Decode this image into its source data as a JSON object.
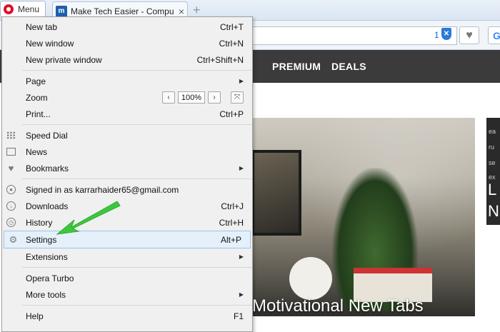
{
  "browser": {
    "menu_button_label": "Menu",
    "tab_title": "Make Tech Easier - Compu",
    "tab_favicon_text": "m",
    "tab_close": "×",
    "new_tab_glyph": "+",
    "blocked_count": "1",
    "search_engine_glyph": "G",
    "accent_color": "#e0112b"
  },
  "site": {
    "nav_links": [
      "PREMIUM",
      "DEALS"
    ],
    "hero_title": "Motivational New Tabs",
    "side_small_lines": [
      "ea",
      "ru",
      "se",
      "ex"
    ],
    "side_big_letters": [
      "L",
      "N"
    ]
  },
  "menu": {
    "items": {
      "new_tab": {
        "label": "New tab",
        "shortcut": "Ctrl+T"
      },
      "new_window": {
        "label": "New window",
        "shortcut": "Ctrl+N"
      },
      "new_private": {
        "label": "New private window",
        "shortcut": "Ctrl+Shift+N"
      },
      "page": {
        "label": "Page"
      },
      "zoom": {
        "label": "Zoom",
        "value": "100%",
        "dec": "‹",
        "inc": "›"
      },
      "print": {
        "label": "Print...",
        "shortcut": "Ctrl+P"
      },
      "speed_dial": {
        "label": "Speed Dial"
      },
      "news": {
        "label": "News"
      },
      "bookmarks": {
        "label": "Bookmarks"
      },
      "signed_in": {
        "label": "Signed in as karrarhaider65@gmail.com"
      },
      "downloads": {
        "label": "Downloads",
        "shortcut": "Ctrl+J"
      },
      "history": {
        "label": "History",
        "shortcut": "Ctrl+H"
      },
      "settings": {
        "label": "Settings",
        "shortcut": "Alt+P"
      },
      "extensions": {
        "label": "Extensions"
      },
      "opera_turbo": {
        "label": "Opera Turbo"
      },
      "more_tools": {
        "label": "More tools"
      },
      "help": {
        "label": "Help",
        "shortcut": "F1"
      }
    },
    "highlighted_item": "settings",
    "annotation_color": "#3cc83c"
  }
}
